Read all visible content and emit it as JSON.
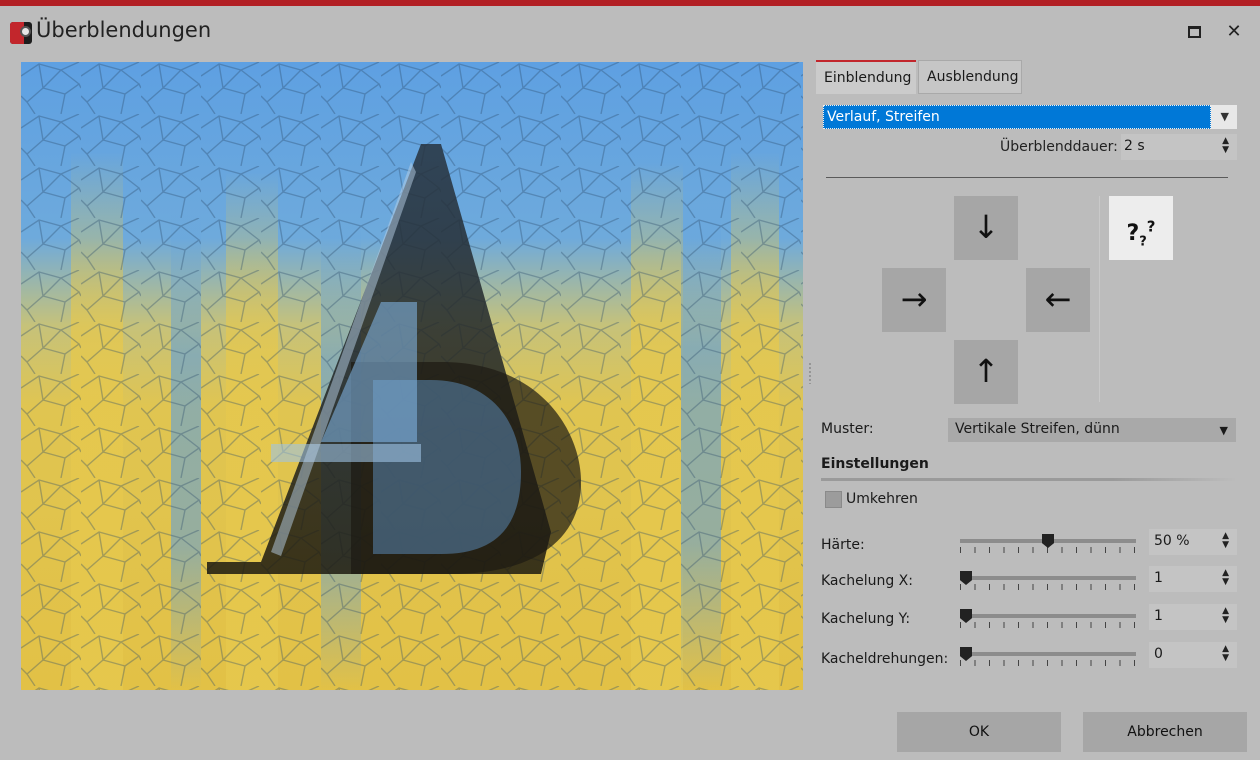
{
  "window": {
    "title": "Überblendungen"
  },
  "tabs": [
    {
      "label": "Einblendung",
      "active": true
    },
    {
      "label": "Ausblendung",
      "active": false
    }
  ],
  "effect": {
    "selected": "Verlauf, Streifen"
  },
  "duration": {
    "label": "Überblenddauer:",
    "value": "2 s"
  },
  "directions": {
    "down": "↓",
    "right": "→",
    "left": "←",
    "up": "↑",
    "random": "?"
  },
  "pattern": {
    "label": "Muster:",
    "value": "Vertikale Streifen, dünn"
  },
  "settings": {
    "heading": "Einstellungen",
    "reverse_label": "Umkehren",
    "reverse_checked": false,
    "hardness": {
      "label": "Härte:",
      "value": "50 %",
      "fraction": 0.5
    },
    "tile_x": {
      "label": "Kachelung X:",
      "value": "1",
      "fraction": 0.0
    },
    "tile_y": {
      "label": "Kachelung Y:",
      "value": "1",
      "fraction": 0.0
    },
    "tile_rot": {
      "label": "Kacheldrehungen:",
      "value": "0",
      "fraction": 0.0
    }
  },
  "buttons": {
    "ok": "OK",
    "cancel": "Abbrechen"
  },
  "colors": {
    "accent": "#b21f24",
    "selection": "#0078d7",
    "sky": "#5a9fe0",
    "gold": "#e3c74d"
  }
}
